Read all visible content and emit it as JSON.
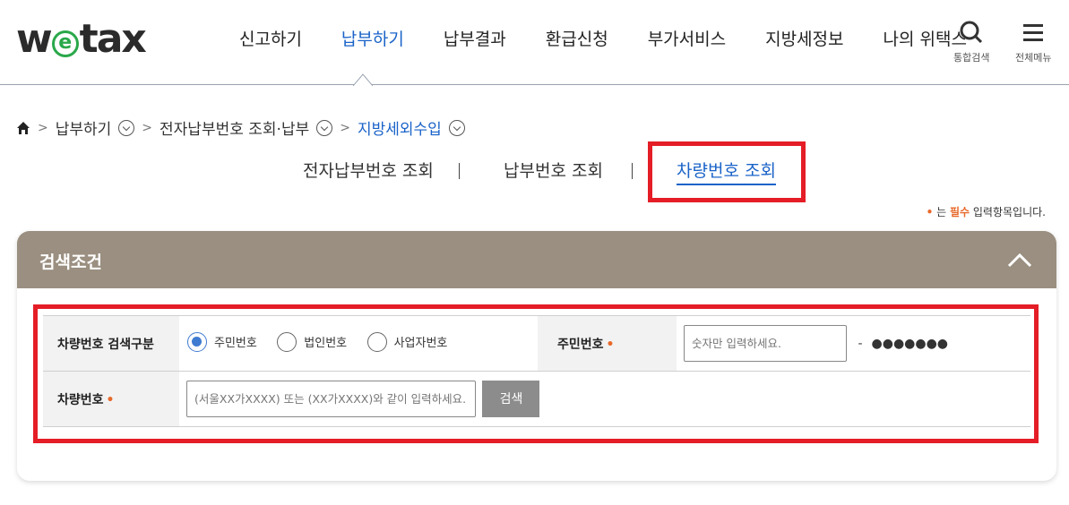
{
  "logo": {
    "pre": "w",
    "e": "e",
    "post": "tax"
  },
  "gnb": [
    "신고하기",
    "납부하기",
    "납부결과",
    "환급신청",
    "부가서비스",
    "지방세정보",
    "나의 위택스"
  ],
  "util": {
    "search": "통합검색",
    "menu": "전체메뉴"
  },
  "breadcrumb": {
    "c1": "납부하기",
    "c2": "전자납부번호 조회·납부",
    "c3": "지방세외수입"
  },
  "tabs": [
    "전자납부번호 조회",
    "납부번호 조회",
    "차량번호 조회"
  ],
  "req_note": {
    "suffix": " 는 ",
    "bold": "필수",
    "tail": " 입력항목입니다.",
    "dot": "•"
  },
  "panel": {
    "title": "검색조건"
  },
  "form": {
    "row1_label": "차량번호 검색구분",
    "radios": [
      "주민번호",
      "법인번호",
      "사업자번호"
    ],
    "id_label": "주민번호",
    "id_placeholder": "숫자만 입력하세요.",
    "dash": "-",
    "masked": "●●●●●●●",
    "row2_label": "차량번호",
    "plate_placeholder": "(서울XX가XXXX) 또는 (XX가XXXX)와 같이 입력하세요.",
    "search_btn": "검색",
    "req_mark": "•"
  },
  "colors": {
    "accent": "#1a63c8",
    "panel_head": "#9a8f80",
    "highlight": "#e41d26",
    "required": "#e8692a"
  }
}
